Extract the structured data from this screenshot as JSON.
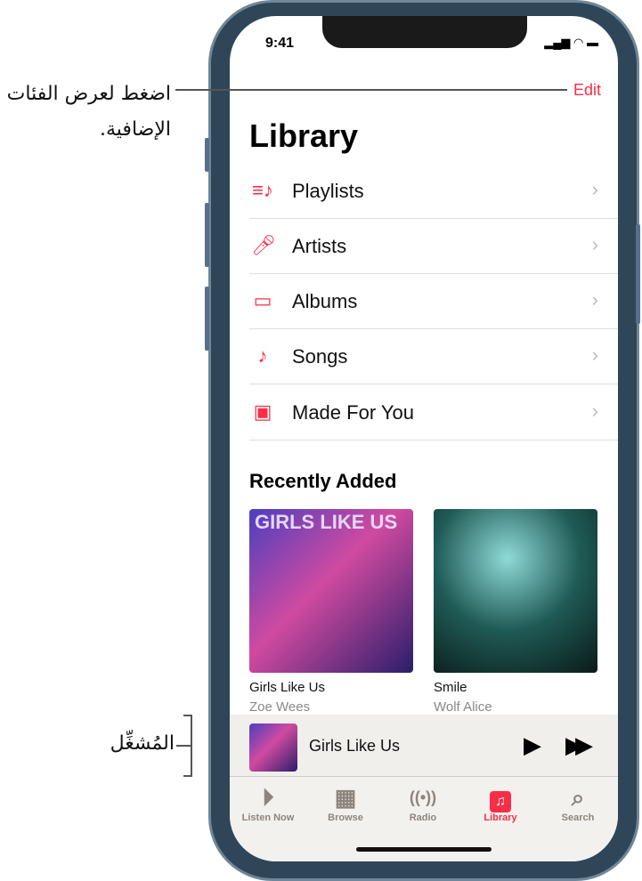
{
  "annotations": {
    "edit_callout": "اضغط لعرض الفئات الإضافية.",
    "player_callout": "المُشغِّل"
  },
  "status": {
    "time": "9:41"
  },
  "header": {
    "edit": "Edit",
    "title": "Library"
  },
  "categories": [
    {
      "label": "Playlists",
      "icon": "playlists-icon"
    },
    {
      "label": "Artists",
      "icon": "microphone-icon"
    },
    {
      "label": "Albums",
      "icon": "albums-icon"
    },
    {
      "label": "Songs",
      "icon": "music-note-icon"
    },
    {
      "label": "Made For You",
      "icon": "person-square-icon"
    }
  ],
  "recently_added": {
    "heading": "Recently Added",
    "albums": [
      {
        "title": "Girls Like Us",
        "artist": "Zoe Wees",
        "cover_text": "GIRLS LIKE US"
      },
      {
        "title": "Smile",
        "artist": "Wolf Alice"
      }
    ]
  },
  "mini_player": {
    "track": "Girls Like Us"
  },
  "tabs": [
    {
      "label": "Listen Now"
    },
    {
      "label": "Browse"
    },
    {
      "label": "Radio"
    },
    {
      "label": "Library",
      "active": true
    },
    {
      "label": "Search"
    }
  ],
  "colors": {
    "accent": "#fa2d48",
    "tab_inactive": "#8d857d"
  }
}
